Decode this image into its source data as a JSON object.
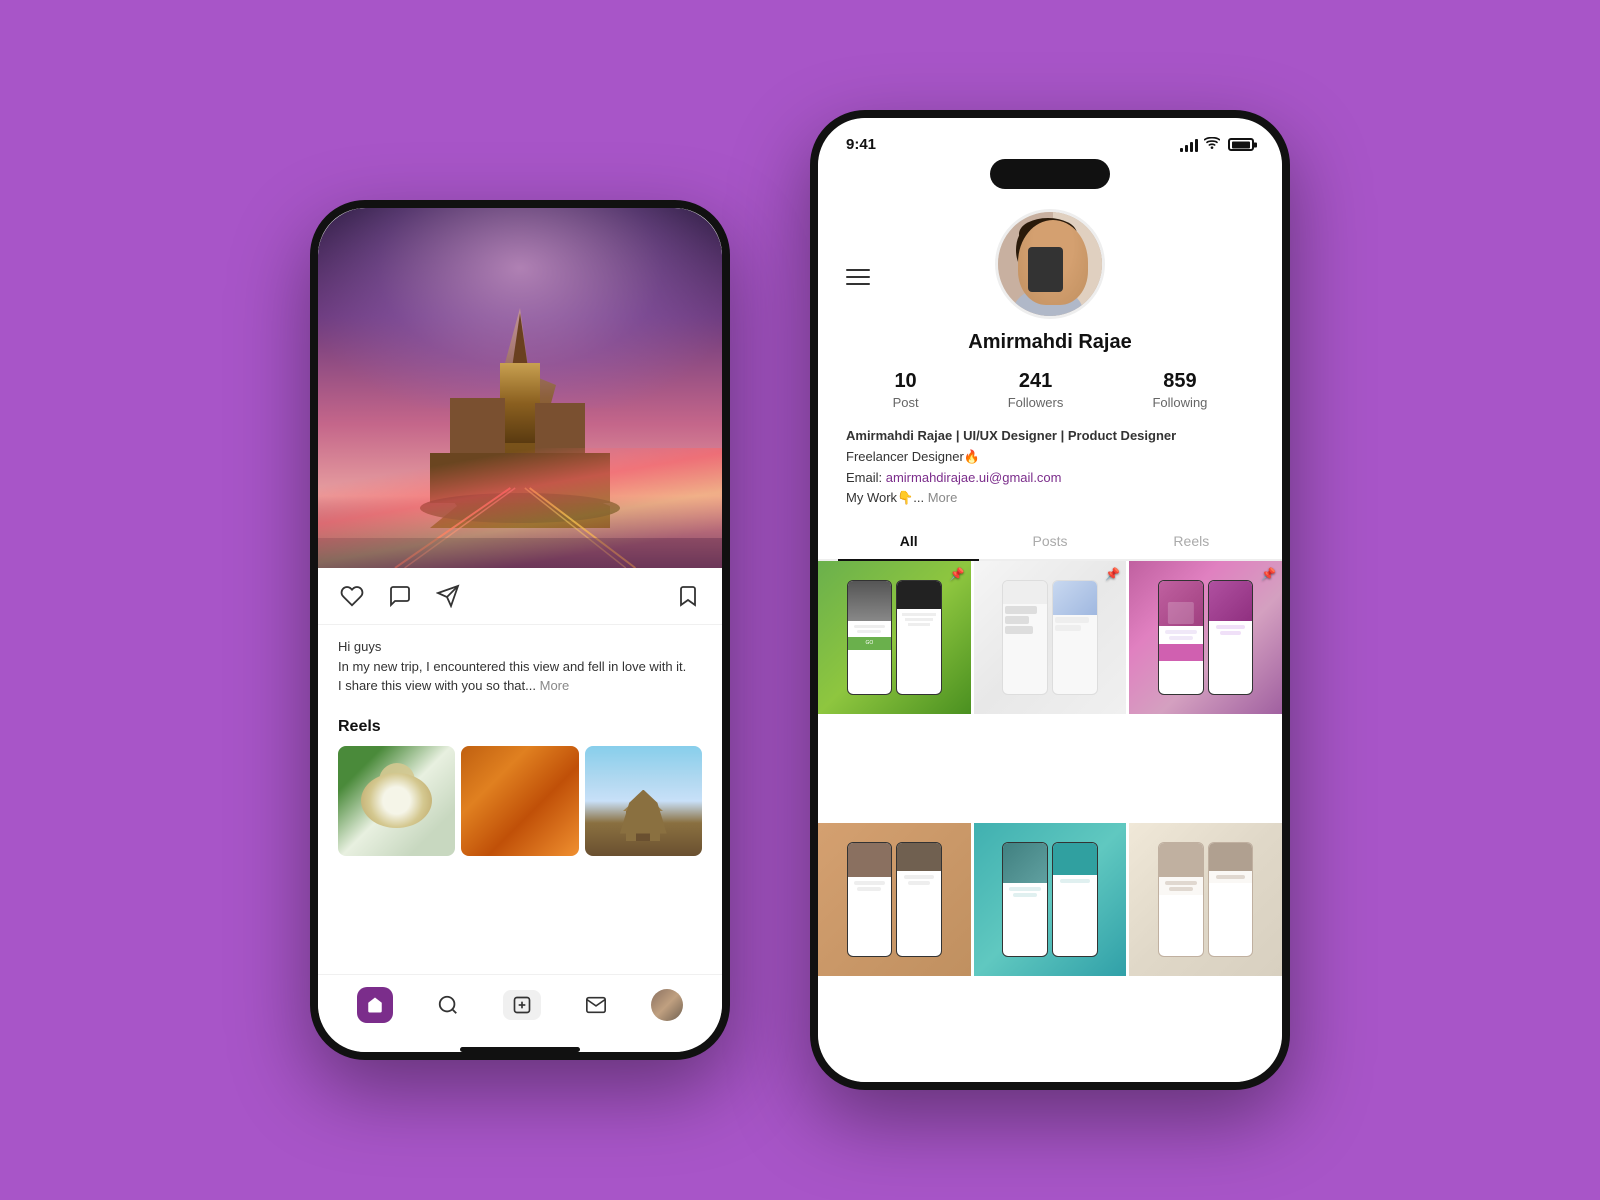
{
  "background_color": "#a855c8",
  "left_phone": {
    "post": {
      "caption_line1": "Hi guys",
      "caption_line2": "In my new trip, I encountered this view and fell in love with it.",
      "caption_line3": "I share this view with you so that...",
      "more_label": "More"
    },
    "reels_section": {
      "title": "Reels"
    },
    "bottom_nav": {
      "home_label": "🏠",
      "search_label": "○",
      "add_label": "+",
      "inbox_label": "✉",
      "avatar_label": ""
    }
  },
  "right_phone": {
    "status_bar": {
      "time": "9:41"
    },
    "profile": {
      "name": "Amirmahdi Rajae",
      "stats": {
        "posts_count": "10",
        "posts_label": "Post",
        "followers_count": "241",
        "followers_label": "Followers",
        "following_count": "859",
        "following_label": "Following"
      },
      "bio_line1": "Amirmahdi Rajae | UI/UX Designer | Product Designer",
      "bio_line2": "Freelancer Designer🔥",
      "bio_email_prefix": "Email: ",
      "bio_email": "amirmahdirajae.ui@gmail.com",
      "bio_work": "My Work👇...",
      "bio_more": "More"
    },
    "tabs": [
      {
        "label": "All",
        "active": true
      },
      {
        "label": "Posts",
        "active": false
      },
      {
        "label": "Reels",
        "active": false
      }
    ],
    "gallery": [
      {
        "bg": "green",
        "type": "phones"
      },
      {
        "bg": "white",
        "type": "phones"
      },
      {
        "bg": "purple",
        "type": "phones"
      },
      {
        "bg": "orange",
        "type": "phones"
      },
      {
        "bg": "blue",
        "type": "phones"
      },
      {
        "bg": "gray",
        "type": "phones"
      }
    ]
  }
}
